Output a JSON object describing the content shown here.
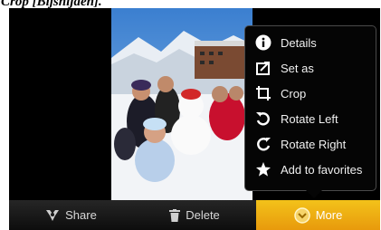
{
  "caption": "Crop [Bijsnijden].",
  "menu": {
    "items": [
      {
        "label": "Details",
        "icon": "info-icon"
      },
      {
        "label": "Set as",
        "icon": "set-as-icon"
      },
      {
        "label": "Crop",
        "icon": "crop-icon"
      },
      {
        "label": "Rotate Left",
        "icon": "rotate-left-icon"
      },
      {
        "label": "Rotate Right",
        "icon": "rotate-right-icon"
      },
      {
        "label": "Add to favorites",
        "icon": "star-icon"
      }
    ]
  },
  "toolbar": {
    "share_label": "Share",
    "delete_label": "Delete",
    "more_label": "More"
  },
  "colors": {
    "accent": "#f0b414",
    "menu_bg": "#050505",
    "toolbar_bg": "#1a1a1a"
  }
}
